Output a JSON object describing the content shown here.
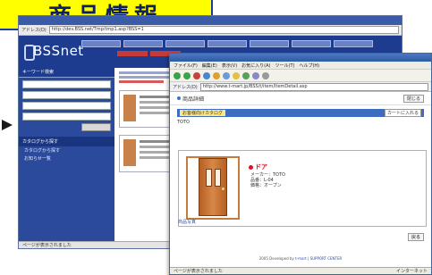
{
  "slide_title": "商品情報",
  "back_window": {
    "address_label": "アドレス(D)",
    "url": "http://dev.BSS.net/Tmp/tmp1.asp?BSS=1",
    "logo": "BSSnet",
    "sidebar": {
      "section1": "キーワード検索",
      "section2": "カタログから探す",
      "links": [
        "カタログから探す",
        "お知らせ一覧"
      ]
    },
    "status_text": "ページが表示されました"
  },
  "front_window": {
    "menu": [
      "ファイル(F)",
      "編集(E)",
      "表示(V)",
      "お気に入り(A)",
      "ツール(T)",
      "ヘルプ(H)"
    ],
    "address_label": "アドレス(D)",
    "url": "http://www.t-mart.jp/BSS/t/item/ItemDetail.asp",
    "page_title": "商品詳細",
    "close_label": "閉じる",
    "tabs": [
      "お客様向けカタログ"
    ],
    "tab_button": "カートに入れる",
    "info_lines": [
      "TOTO"
    ],
    "product": {
      "name": "ドア",
      "info": [
        "メーカー：TOTO",
        "品番：L-04",
        "価格：オープン"
      ]
    },
    "caption": [
      "商品写真"
    ],
    "back_label": "戻る",
    "copyright_text": "2005 Developed by",
    "copyright_links": [
      "t-mart",
      "SUPPORT CENTER"
    ],
    "status_left": "ページが表示されました",
    "status_right": "インターネット"
  }
}
